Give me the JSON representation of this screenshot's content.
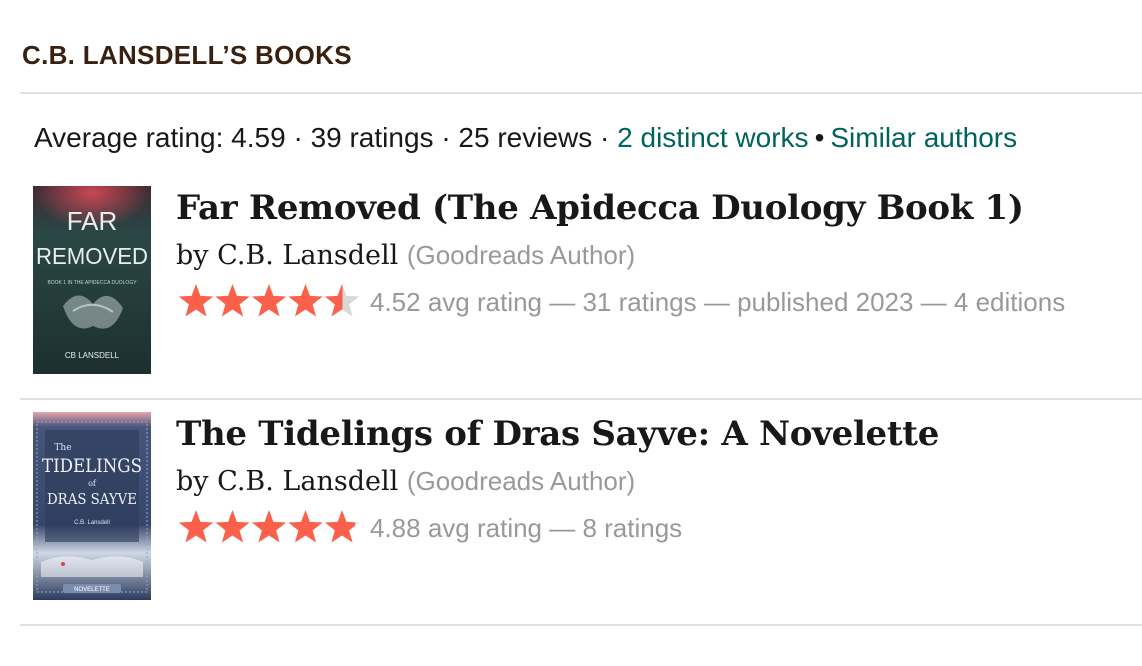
{
  "header": {
    "title": "C.B. LANSDELL’S BOOKS"
  },
  "stats": {
    "avg_rating": "Average rating: 4.59",
    "sep1": "·",
    "ratings": "39 ratings",
    "sep2": "·",
    "reviews": "25 reviews",
    "sep3": "·",
    "distinct_works": "2 distinct works",
    "bullet": "•",
    "similar_authors": "Similar authors"
  },
  "books": [
    {
      "title": "Far Removed (The Apidecca Duology Book 1)",
      "by": "by",
      "author": "C.B. Lansdell",
      "author_role": "(Goodreads Author)",
      "rating": 4.52,
      "rating_text": "4.52 avg rating — 31 ratings — published 2023 — 4 editions",
      "cover": {
        "title_line1": "FAR",
        "title_line2": "REMOVED",
        "subtitle": "BOOK 1 IN THE APIDECCA DUOLOGY",
        "author": "CB LANSDELL",
        "bg": "#24403f",
        "accent": "#c2434f"
      }
    },
    {
      "title": "The Tidelings of Dras Sayve: A Novelette",
      "by": "by",
      "author": "C.B. Lansdell",
      "author_role": "(Goodreads Author)",
      "rating": 4.88,
      "rating_text": "4.88 avg rating — 8 ratings",
      "cover": {
        "title_line1": "The",
        "title_line2": "TIDELINGS",
        "title_line3": "of",
        "title_line4": "DRAS SAYVE",
        "author": "C.B. Lansdell",
        "badge": "NOVELETTE",
        "bg": "#3a4d72",
        "accent": "#d9484f"
      }
    }
  ],
  "colors": {
    "star": "#fa604a",
    "star_empty": "#d8d8d8",
    "link": "#00635d",
    "header": "#382110",
    "muted": "#999999"
  }
}
